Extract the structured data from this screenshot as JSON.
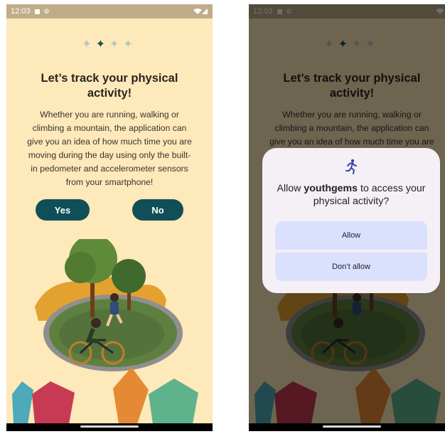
{
  "status": {
    "time": "12:03",
    "signal_icon": "wifi-cell-icon"
  },
  "onboarding": {
    "progress": {
      "total": 4,
      "active_index": 1
    },
    "title": "Let’s track your physical activity!",
    "description": "Whether you are running, walking or climbing a mountain, the application can give you an idea of how much time you are moving during the day using only the built-in pedometer and accelerometer sensors from your smartphone!",
    "yes_label": "Yes",
    "no_label": "No"
  },
  "permission_dialog": {
    "icon": "running-person-icon",
    "title_prefix": "Allow ",
    "app_name": "youthgems",
    "title_suffix": " to access your physical activity?",
    "allow_label": "Allow",
    "deny_label": "Don’t allow"
  },
  "colors": {
    "background": "#fde9b9",
    "accent": "#104f58",
    "dialog_button": "#dbe1fc",
    "dialog_bg": "#f4f0f6"
  }
}
